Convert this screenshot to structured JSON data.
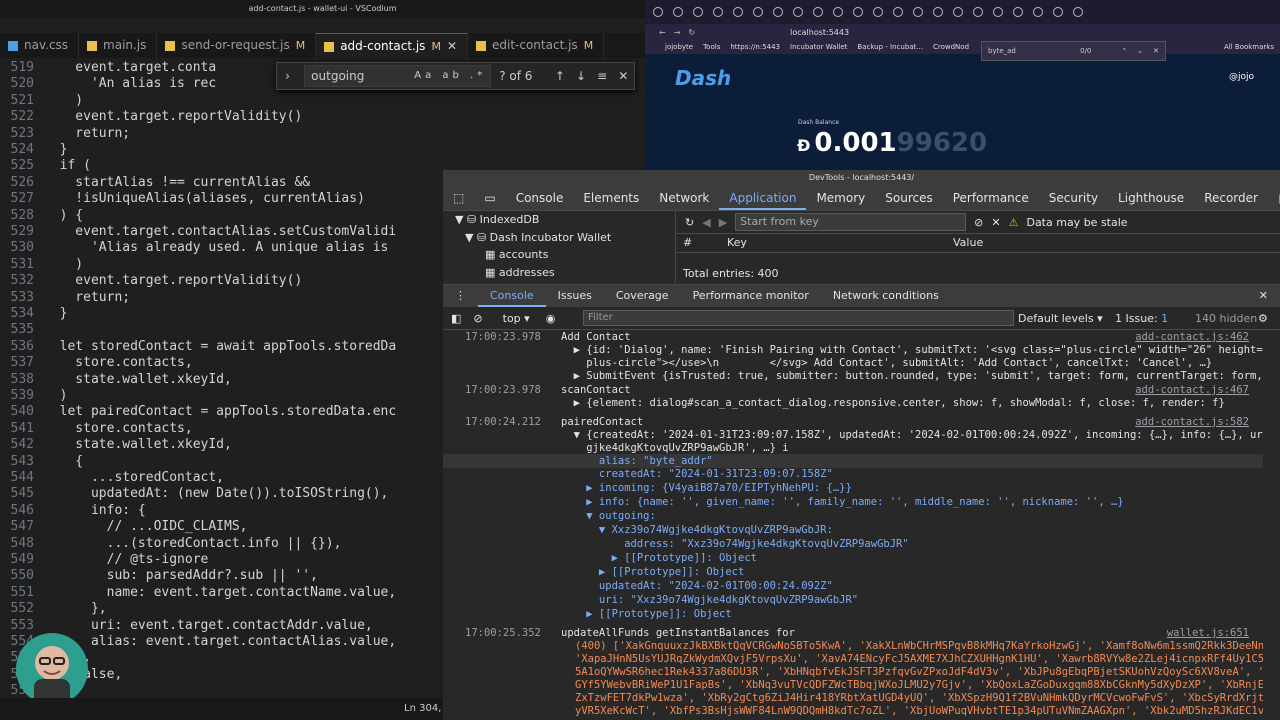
{
  "vscode": {
    "title": "add-contact.js - wallet-ui - VSCodium",
    "tabs": [
      {
        "label": "nav.css",
        "mod": "",
        "icon": "css"
      },
      {
        "label": "main.js",
        "mod": "",
        "icon": "js"
      },
      {
        "label": "send-or-request.js",
        "mod": "M",
        "icon": "js"
      },
      {
        "label": "add-contact.js",
        "mod": "M",
        "icon": "js"
      },
      {
        "label": "edit-contact.js",
        "mod": "M",
        "icon": "js"
      }
    ],
    "find": {
      "query": "outgoing",
      "count": "? of 6",
      "opts": "Aa ab .*"
    },
    "status": "Ln 304,",
    "lines": [
      {
        "n": "519",
        "t": "    event.target.conta"
      },
      {
        "n": "520",
        "t": "      'An alias is rec"
      },
      {
        "n": "521",
        "t": "    )"
      },
      {
        "n": "522",
        "t": "    event.target.reportValidity()"
      },
      {
        "n": "523",
        "t": "    return;"
      },
      {
        "n": "524",
        "t": "  }"
      },
      {
        "n": "525",
        "t": "  if ("
      },
      {
        "n": "526",
        "t": "    startAlias !== currentAlias &&"
      },
      {
        "n": "527",
        "t": "    !isUniqueAlias(aliases, currentAlias)"
      },
      {
        "n": "528",
        "t": "  ) {"
      },
      {
        "n": "529",
        "t": "    event.target.contactAlias.setCustomValidi"
      },
      {
        "n": "530",
        "t": "      'Alias already used. A unique alias is"
      },
      {
        "n": "531",
        "t": "    )"
      },
      {
        "n": "532",
        "t": "    event.target.reportValidity()"
      },
      {
        "n": "533",
        "t": "    return;"
      },
      {
        "n": "534",
        "t": "  }"
      },
      {
        "n": "535",
        "t": ""
      },
      {
        "n": "536",
        "t": "  let storedContact = await appTools.storedDa"
      },
      {
        "n": "537",
        "t": "    store.contacts,"
      },
      {
        "n": "538",
        "t": "    state.wallet.xkeyId,"
      },
      {
        "n": "539",
        "t": "  )"
      },
      {
        "n": "540",
        "t": "  let pairedContact = appTools.storedData.enc"
      },
      {
        "n": "541",
        "t": "    store.contacts,"
      },
      {
        "n": "542",
        "t": "    state.wallet.xkeyId,"
      },
      {
        "n": "543",
        "t": "    {"
      },
      {
        "n": "544",
        "t": "      ...storedContact,"
      },
      {
        "n": "545",
        "t": "      updatedAt: (new Date()).toISOString(),"
      },
      {
        "n": "546",
        "t": "      info: {"
      },
      {
        "n": "547",
        "t": "        // ...OIDC_CLAIMS,"
      },
      {
        "n": "548",
        "t": "        ...(storedContact.info || {}),"
      },
      {
        "n": "549",
        "t": "        // @ts-ignore"
      },
      {
        "n": "550",
        "t": "        sub: parsedAddr?.sub || '',"
      },
      {
        "n": "551",
        "t": "        name: event.target.contactName.value,"
      },
      {
        "n": "552",
        "t": "      },"
      },
      {
        "n": "553",
        "t": "      uri: event.target.contactAddr.value,"
      },
      {
        "n": "554",
        "t": "      alias: event.target.contactAlias.value,"
      },
      {
        "n": "555",
        "t": "    },"
      },
      {
        "n": "556",
        "t": "    false,"
      },
      {
        "n": "557",
        "t": "  )"
      }
    ]
  },
  "browser": {
    "url": "localhost:5443",
    "bookmarks": [
      "jojobyte",
      "Tools",
      "https://n:5443",
      "Incubator Wallet",
      "Backup - Incubat...",
      "CrowdNod",
      "All Bookmarks"
    ],
    "find_text": "byte_ad",
    "find_count": "0/0",
    "logo": "Dash",
    "user": "@jojo",
    "balance_label": "Dash Balance",
    "balance_main": "0.001",
    "balance_dim": "99620"
  },
  "devtools": {
    "title": "DevTools - localhost:5443/",
    "tabs": [
      "Console",
      "Elements",
      "Network",
      "Application",
      "Memory",
      "Sources",
      "Performance",
      "Security",
      "Lighthouse",
      "Recorder"
    ],
    "active_tab": "Application",
    "issues_badge": "1",
    "tree": [
      "IndexedDB",
      "Dash Incubator Wallet",
      "accounts",
      "addresses"
    ],
    "kv_filter_placeholder": "Start from key",
    "stale": "Data may be stale",
    "col_hash": "#",
    "col_key": "Key",
    "col_value": "Value",
    "total": "Total entries: 400",
    "drawer_tabs": [
      "Console",
      "Issues",
      "Coverage",
      "Performance monitor",
      "Network conditions"
    ],
    "context": "top",
    "filter_placeholder": "Filter",
    "levels": "Default levels",
    "issue_count": "1 Issue:",
    "issue_num": "1",
    "hidden": "140 hidden",
    "console_lines": [
      {
        "ts": "17:00:23.978",
        "t": "Add Contact",
        "src": "add-contact.js:462"
      },
      {
        "ts": "",
        "t": "  ▶ {id: 'Dialog', name: 'Finish Pairing with Contact', submitTxt: '<svg class=\"plus-circle\" width=\"26\" height=\"26\" vi…icon-",
        "src": ""
      },
      {
        "ts": "",
        "t": "    plus-circle\"></use>\\n        </svg> Add Contact', submitAlt: 'Add Contact', cancelTxt: 'Cancel', …}",
        "src": ""
      },
      {
        "ts": "",
        "t": "  ▶ SubmitEvent {isTrusted: true, submitter: button.rounded, type: 'submit', target: form, currentTarget: form, …}",
        "src": ""
      },
      {
        "ts": "17:00:23.978",
        "t": "scanContact",
        "src": "add-contact.js:467"
      },
      {
        "ts": "",
        "t": "  ▶ {element: dialog#scan_a_contact_dialog.responsive.center, show: f, showModal: f, close: f, render: f}",
        "src": ""
      },
      {
        "ts": "17:00:24.212",
        "t": "pairedContact",
        "src": "add-contact.js:582"
      },
      {
        "ts": "",
        "t": "  ▼ {createdAt: '2024-01-31T23:09:07.158Z', updatedAt: '2024-02-01T00:00:24.092Z', incoming: {…}, info: {…}, uri: 'Xxz39o74W",
        "src": ""
      },
      {
        "ts": "",
        "t": "    gjke4dkgKtovqUvZRP9awGbJR', …} i",
        "src": ""
      },
      {
        "ts": "",
        "t": "      alias: \"byte_addr\"",
        "src": ""
      },
      {
        "ts": "",
        "t": "      createdAt: \"2024-01-31T23:09:07.158Z\"",
        "src": ""
      },
      {
        "ts": "",
        "t": "    ▶ incoming: {V4yaiB87a70/EIPTyhNehPU: {…}}",
        "src": ""
      },
      {
        "ts": "",
        "t": "    ▶ info: {name: '', given_name: '', family_name: '', middle_name: '', nickname: '', …}",
        "src": ""
      },
      {
        "ts": "",
        "t": "    ▼ outgoing:",
        "src": ""
      },
      {
        "ts": "",
        "t": "      ▼ Xxz39o74Wgjke4dkgKtovqUvZRP9awGbJR:",
        "src": ""
      },
      {
        "ts": "",
        "t": "          address: \"Xxz39o74Wgjke4dkgKtovqUvZRP9awGbJR\"",
        "src": ""
      },
      {
        "ts": "",
        "t": "        ▶ [[Prototype]]: Object",
        "src": ""
      },
      {
        "ts": "",
        "t": "      ▶ [[Prototype]]: Object",
        "src": ""
      },
      {
        "ts": "",
        "t": "      updatedAt: \"2024-02-01T00:00:24.092Z\"",
        "src": ""
      },
      {
        "ts": "",
        "t": "      uri: \"Xxz39o74Wgjke4dkgKtovqUvZRP9awGbJR\"",
        "src": ""
      },
      {
        "ts": "",
        "t": "    ▶ [[Prototype]]: Object",
        "src": ""
      },
      {
        "ts": "17:00:25.352",
        "t": "updateAllFunds getInstantBalances for",
        "src": "wallet.js:651"
      },
      {
        "ts": "",
        "t": "(400) ['XakGnquuxzJkBXBktQqVCRGwNoSBTo5KwA', 'XakXLnWbCHrMSPqvB8kMHq7KaYrkoHzwGj', 'Xamf8oNw6m1ssmQ2Rkk3DeeNn9r5PqtpkP',",
        "src": ""
      },
      {
        "ts": "",
        "t": "'XapaJHnN5UsYUJRqZkWydmXQvjF5VrpsXu', 'XavA74ENcyFcJ5AXME7XJhCZXUHHgnK1HU', 'Xawrb8RVYw8e2ZLej4icnpxRFf4Uy1C5wW', 'XbGnG",
        "src": ""
      },
      {
        "ts": "",
        "t": "5A1oQYWwSR6hec1Rek4337a86DU3R', 'XbHNqbfvEkJSFT3PzfqvGvZPxoJdF4dV3v', 'XbJPu8gEbqPBjetSKUohVzQoySc6XV8veA', 'XbMvmFFjgoZ",
        "src": ""
      },
      {
        "ts": "",
        "t": "GYf5YWebvBRiWeP1U1FapBs', 'XbNq3vuTVcQDFZWcTBbqjWXoJLMU2y7Gjv', 'XbQoxLaZGoDuxgqm88XbCGknMy5dXyDzXP', 'XbRnjE86H43wAzHMv",
        "src": ""
      },
      {
        "ts": "",
        "t": "ZxTzwFET7dkPw1wza', 'XbRy2gCtg6ZiJ4Hir418YRbtXatUGD4yUQ', 'XbXSpzH9Q1f2BVuNHmkQDyrMCVcwoFwFvS', 'XbcSyRrdXrjtDA47d2bPPEA",
        "src": ""
      },
      {
        "ts": "",
        "t": "yVR5XeKcWcT', 'XbfPs3BsHjsWWF84LnW9QDQmH8kdTc7oZL', 'XbjUoWPuqVHvbtTE1p34pUTuVNmZAAGXpn', 'Xbk2uMD5hzRJKdEC1v75mWA5Pfx9y",
        "src": ""
      }
    ]
  }
}
